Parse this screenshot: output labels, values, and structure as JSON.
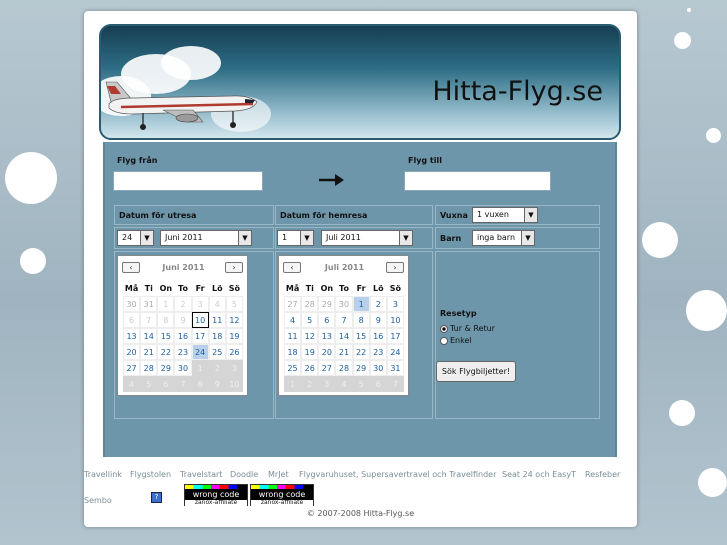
{
  "header": {
    "title": "Hitta-Flyg.se"
  },
  "form": {
    "from_label": "Flyg från",
    "to_label": "Flyg till",
    "depart_label": "Datum för utresa",
    "return_label": "Datum för hemresa",
    "adults_label": "Vuxna",
    "children_label": "Barn",
    "depart_day": "24",
    "depart_month": "Juni 2011",
    "return_day": "1",
    "return_month": "Juli 2011",
    "adults_value": "1 vuxen",
    "children_value": "inga barn",
    "trip_type_label": "Resetyp",
    "trip_round": "Tur & Retur",
    "trip_oneway": "Enkel",
    "search_button": "Sök Flygbiljetter!"
  },
  "calendar_depart": {
    "month": "Juni 2011",
    "weekdays": [
      "Må",
      "Ti",
      "On",
      "To",
      "Fr",
      "Lö",
      "Sö"
    ],
    "weeks": [
      [
        "30",
        "31",
        "1",
        "2",
        "3",
        "4",
        "5"
      ],
      [
        "6",
        "7",
        "8",
        "9",
        "10",
        "11",
        "12"
      ],
      [
        "13",
        "14",
        "15",
        "16",
        "17",
        "18",
        "19"
      ],
      [
        "20",
        "21",
        "22",
        "23",
        "24",
        "25",
        "26"
      ],
      [
        "27",
        "28",
        "29",
        "30",
        "1",
        "2",
        "3"
      ],
      [
        "4",
        "5",
        "6",
        "7",
        "8",
        "9",
        "10"
      ]
    ]
  },
  "calendar_return": {
    "month": "Juli 2011",
    "weekdays": [
      "Må",
      "Ti",
      "On",
      "To",
      "Fr",
      "Lö",
      "Sö"
    ],
    "weeks": [
      [
        "27",
        "28",
        "29",
        "30",
        "1",
        "2",
        "3"
      ],
      [
        "4",
        "5",
        "6",
        "7",
        "8",
        "9",
        "10"
      ],
      [
        "11",
        "12",
        "13",
        "14",
        "15",
        "16",
        "17"
      ],
      [
        "18",
        "19",
        "20",
        "21",
        "22",
        "23",
        "24"
      ],
      [
        "25",
        "26",
        "27",
        "28",
        "29",
        "30",
        "31"
      ],
      [
        "1",
        "2",
        "3",
        "4",
        "5",
        "6",
        "7"
      ]
    ]
  },
  "icons": {
    "arrow": "right-arrow-icon",
    "prev": "prev-month-icon",
    "next": "next-month-icon"
  },
  "footer": {
    "links": [
      "Travellink",
      "Flygstolen",
      "Travelstart",
      "Doodle",
      "MrJet",
      "Flygvaruhuset, Supersavertravel och Travelfinder",
      "Seat 24 och EasyT",
      "Resfeber",
      "Sembo"
    ],
    "badge1": "wrong code",
    "badge2": "wrong code",
    "badge_sub": "zanox-affiliate",
    "copyright": "© 2007-2008 Hitta-Flyg.se"
  },
  "colors": {
    "panel": "#6e96ab",
    "link": "#1c5fa0",
    "today_highlight": "#b8d0ea"
  }
}
